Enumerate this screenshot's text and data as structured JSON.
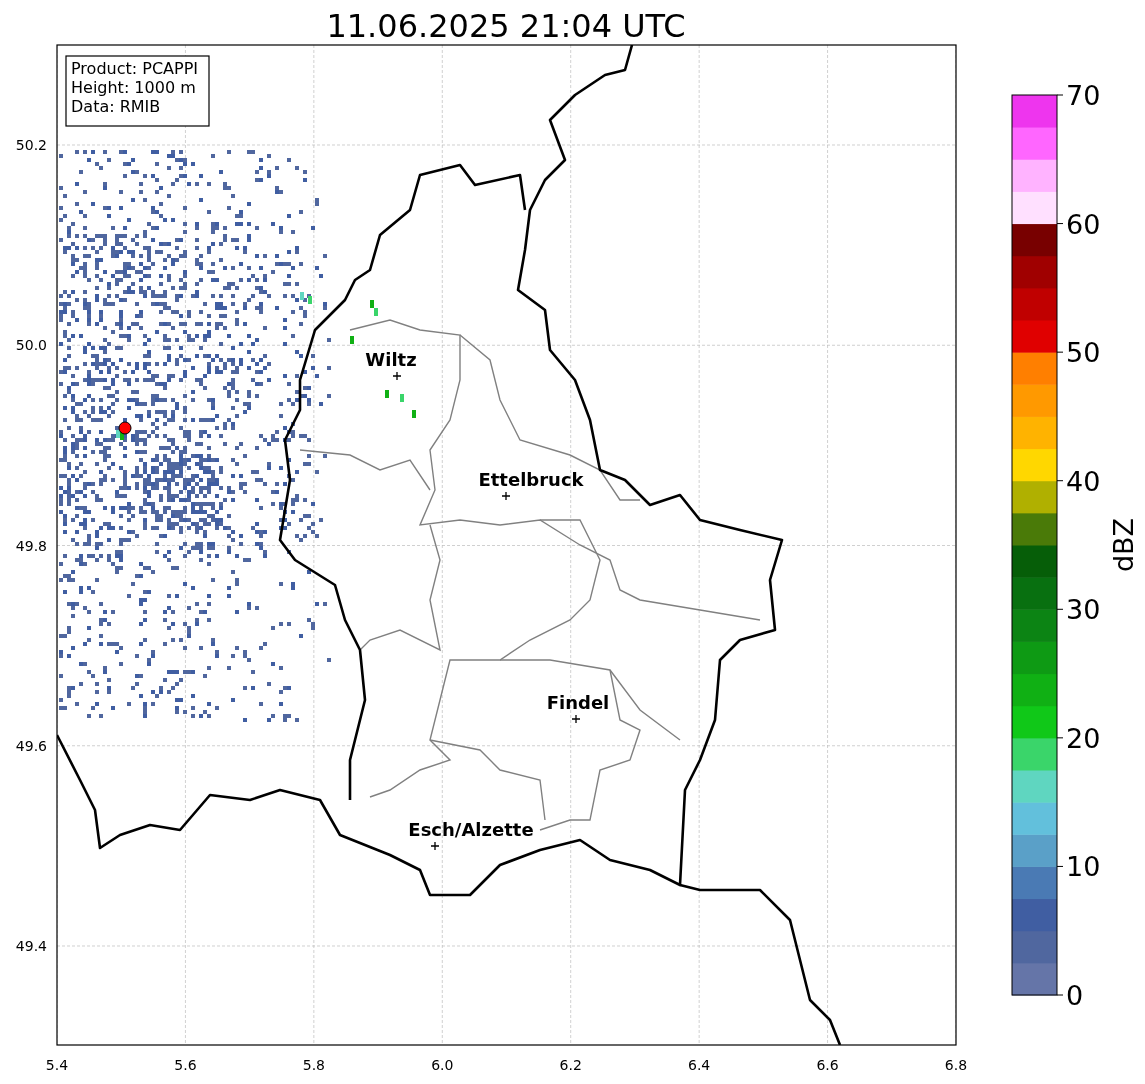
{
  "title": "11.06.2025 21:04 UTC",
  "info_box": {
    "lines": [
      "Product: PCAPPI",
      "Height: 1000 m",
      "Data: RMIB"
    ]
  },
  "axes": {
    "xticks": [
      "5.4",
      "5.6",
      "5.8",
      "6.0",
      "6.2",
      "6.4",
      "6.6",
      "6.8"
    ],
    "yticks": [
      "50.2",
      "50.0",
      "49.8",
      "49.6",
      "49.4"
    ]
  },
  "places": [
    {
      "name": "Wiltz"
    },
    {
      "name": "Ettelbruck"
    },
    {
      "name": "Findel"
    },
    {
      "name": "Esch/Alzette"
    }
  ],
  "colorbar": {
    "label": "dBZ",
    "ticks": [
      "70",
      "60",
      "50",
      "40",
      "30",
      "20",
      "10",
      "0"
    ],
    "bands": [
      {
        "color": "#6575a8"
      },
      {
        "color": "#50679f"
      },
      {
        "color": "#405ea2"
      },
      {
        "color": "#4a7ab4"
      },
      {
        "color": "#5aa0c8"
      },
      {
        "color": "#62c0dc"
      },
      {
        "color": "#5fd6c0"
      },
      {
        "color": "#3ad56a"
      },
      {
        "color": "#10c818"
      },
      {
        "color": "#10b014"
      },
      {
        "color": "#0e9a14"
      },
      {
        "color": "#0c8414"
      },
      {
        "color": "#087010"
      },
      {
        "color": "#065e08"
      },
      {
        "color": "#4a7a08"
      },
      {
        "color": "#b0b000"
      },
      {
        "color": "#ffd700"
      },
      {
        "color": "#ffb300"
      },
      {
        "color": "#ff9900"
      },
      {
        "color": "#ff7f00"
      },
      {
        "color": "#e00000"
      },
      {
        "color": "#c00000"
      },
      {
        "color": "#a00000"
      },
      {
        "color": "#780000"
      },
      {
        "color": "#ffe0ff"
      },
      {
        "color": "#ffb3ff"
      },
      {
        "color": "#ff66ff"
      },
      {
        "color": "#ee35ee"
      }
    ]
  }
}
